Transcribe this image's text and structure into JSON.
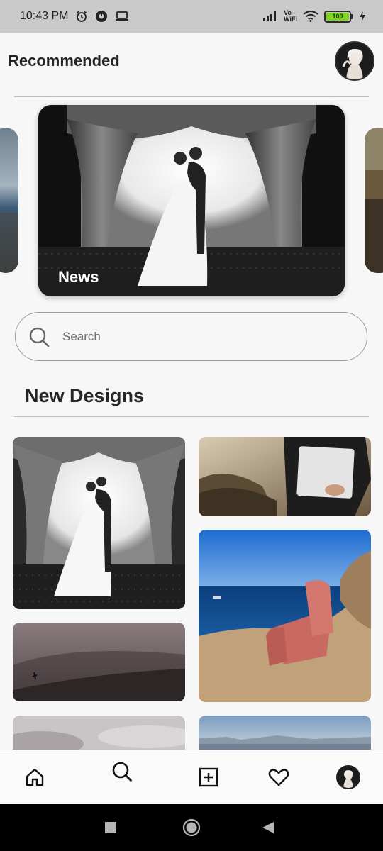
{
  "status_bar": {
    "time": "10:43 PM",
    "network_label_top": "Vo",
    "network_label_bottom": "WiFi",
    "battery": "100"
  },
  "header": {
    "title": "Recommended"
  },
  "carousel": {
    "cards": [
      {
        "label": "News"
      }
    ]
  },
  "search": {
    "placeholder": "Search",
    "value": ""
  },
  "section": {
    "title": "New Designs"
  },
  "nav": {
    "items": [
      "home-icon",
      "search-icon",
      "add-post-icon",
      "heart-icon",
      "profile-avatar"
    ]
  },
  "system_nav": {
    "items": [
      "recents-icon",
      "home-circle-icon",
      "back-icon"
    ]
  },
  "colors": {
    "background": "#f7f7f7",
    "status_bar": "#c9c9c9",
    "battery_fill": "#7ed321",
    "text": "#262626"
  }
}
